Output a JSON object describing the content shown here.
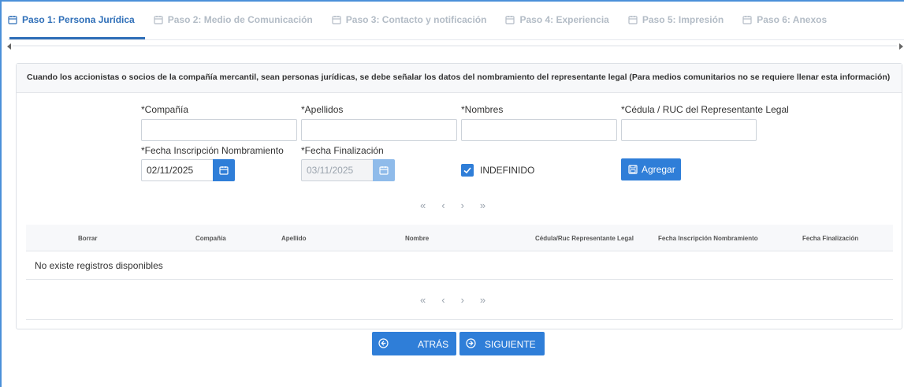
{
  "tabs": [
    {
      "label": "Paso 1: Persona Jurídica",
      "active": true
    },
    {
      "label": "Paso 2: Medio de Comunicación",
      "active": false
    },
    {
      "label": "Paso 3: Contacto y notificación",
      "active": false
    },
    {
      "label": "Paso 4: Experiencia",
      "active": false
    },
    {
      "label": "Paso 5: Impresión",
      "active": false
    },
    {
      "label": "Paso 6: Anexos",
      "active": false
    }
  ],
  "panel": {
    "header": "Cuando los accionistas o socios de la compañía mercantil, sean personas jurídicas, se debe señalar los datos del nombramiento del representante legal (Para medios comunitarios no se requiere llenar esta información)"
  },
  "form": {
    "compania_label": "*Compañía",
    "compania_value": "",
    "apellidos_label": "*Apellidos",
    "apellidos_value": "",
    "nombres_label": "*Nombres",
    "nombres_value": "",
    "cedula_label": "*Cédula / RUC del Representante Legal",
    "cedula_value": "",
    "fecha_inscripcion_label": "*Fecha Inscripción Nombramiento",
    "fecha_inscripcion_value": "02/11/2025",
    "fecha_finalizacion_label": "*Fecha Finalización",
    "fecha_finalizacion_value": "03/11/2025",
    "indefinido_label": "INDEFINIDO",
    "indefinido_checked": true,
    "agregar_label": "Agregar"
  },
  "pager": {
    "first": "«",
    "prev": "‹",
    "next": "›",
    "last": "»"
  },
  "table": {
    "columns": [
      "Borrar",
      "Compañía",
      "Apellido",
      "Nombre",
      "Cédula/Ruc Representante Legal",
      "Fecha Inscripción Nombramiento",
      "Fecha Finalización"
    ],
    "empty_text": "No existe registros disponibles"
  },
  "nav": {
    "back_label": "ATRÁS",
    "next_label": "SIGUIENTE"
  },
  "colors": {
    "accent": "#2f7ed8",
    "active_tab": "#2f6fb8",
    "inactive_tab": "#b3bcc6"
  }
}
